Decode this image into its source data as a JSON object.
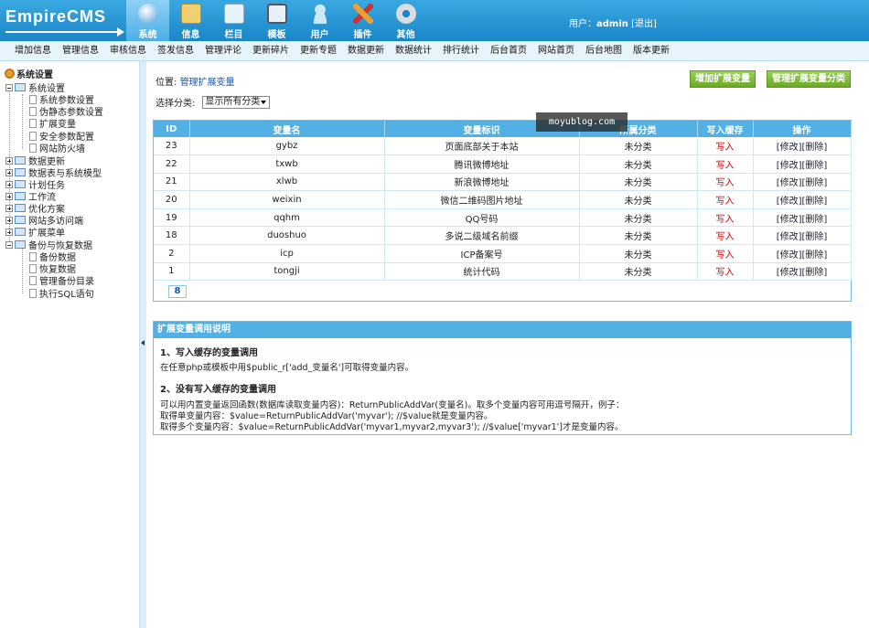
{
  "header": {
    "logo_text": "EmpireCMS",
    "nav": [
      {
        "label": "系统",
        "icon": "globe-icon",
        "color": "#4a9fd8"
      },
      {
        "label": "信息",
        "icon": "document-edit-icon",
        "color": "#f0d070"
      },
      {
        "label": "栏目",
        "icon": "folder-icon",
        "color": "#e8f4fc"
      },
      {
        "label": "模板",
        "icon": "template-window-icon",
        "color": "#e8f0f8"
      },
      {
        "label": "用户",
        "icon": "user-icon",
        "color": "#cfe8f8"
      },
      {
        "label": "插件",
        "icon": "tools-icon",
        "color": "#f0a030"
      },
      {
        "label": "其他",
        "icon": "gear-icon",
        "color": "#d8dde2"
      }
    ],
    "user_prefix": "用户：",
    "username": "admin",
    "logout": "[退出]"
  },
  "subnav": [
    "增加信息",
    "管理信息",
    "审核信息",
    "签发信息",
    "管理评论",
    "更新碎片",
    "更新专题",
    "数据更新",
    "数据统计",
    "排行统计",
    "后台首页",
    "网站首页",
    "后台地图",
    "版本更新"
  ],
  "sidebar": {
    "root": "系统设置",
    "items": [
      {
        "label": "系统设置"
      },
      {
        "label": "系统参数设置"
      },
      {
        "label": "伪静态参数设置"
      },
      {
        "label": "扩展变量"
      },
      {
        "label": "安全参数配置"
      },
      {
        "label": "网站防火墙"
      },
      {
        "label": "数据更新"
      },
      {
        "label": "数据表与系统模型"
      },
      {
        "label": "计划任务"
      },
      {
        "label": "工作流"
      },
      {
        "label": "优化方案"
      },
      {
        "label": "网站多访问端"
      },
      {
        "label": "扩展菜单"
      },
      {
        "label": "备份与恢复数据"
      },
      {
        "label": "备份数据"
      },
      {
        "label": "恢复数据"
      },
      {
        "label": "管理备份目录"
      },
      {
        "label": "执行SQL语句"
      }
    ]
  },
  "main": {
    "location_prefix": "位置:",
    "location_link": "管理扩展变量",
    "btn_add": "增加扩展变量",
    "btn_manage_class": "管理扩展变量分类",
    "filter_label": "选择分类:",
    "filter_value": "显示所有分类",
    "watermark": "moyublog.com",
    "table": {
      "headers": [
        "ID",
        "变量名",
        "变量标识",
        "所属分类",
        "写入缓存",
        "操作"
      ],
      "rows": [
        [
          "23",
          "gybz",
          "页面底部关于本站",
          "未分类",
          "写入"
        ],
        [
          "22",
          "txwb",
          "腾讯微博地址",
          "未分类",
          "写入"
        ],
        [
          "21",
          "xlwb",
          "新浪微博地址",
          "未分类",
          "写入"
        ],
        [
          "20",
          "weixin",
          "微信二维码图片地址",
          "未分类",
          "写入"
        ],
        [
          "19",
          "qqhm",
          "QQ号码",
          "未分类",
          "写入"
        ],
        [
          "18",
          "duoshuo",
          "多说二级域名前缀",
          "未分类",
          "写入"
        ],
        [
          "2",
          "icp",
          "ICP备案号",
          "未分类",
          "写入"
        ],
        [
          "1",
          "tongji",
          "统计代码",
          "未分类",
          "写入"
        ]
      ],
      "edit_label": "[修改]",
      "delete_label": "[删除]",
      "page": "8"
    },
    "help": {
      "title": "扩展变量调用说明",
      "h1": "1、写入缓存的变量调用",
      "p1": "在任意php或模板中用$public_r['add_变量名']可取得变量内容。",
      "h2": "2、没有写入缓存的变量调用",
      "p2": "可以用内置变量返回函数(数据库读取变量内容)：ReturnPublicAddVar(变量名)。取多个变量内容可用逗号隔开，例子：",
      "p3": "取得单变量内容：$value=ReturnPublicAddVar('myvar'); //$value就是变量内容。",
      "p4": "取得多个变量内容：$value=ReturnPublicAddVar('myvar1,myvar2,myvar3'); //$value['myvar1']才是变量内容。"
    }
  }
}
